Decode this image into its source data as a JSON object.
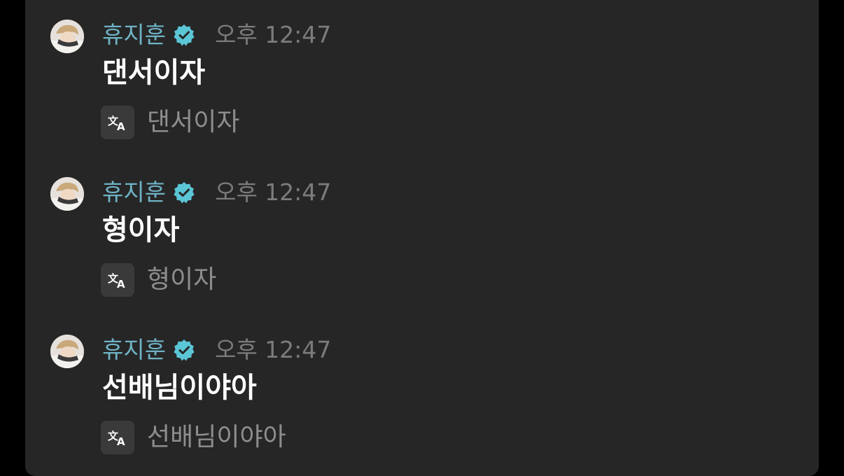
{
  "messages": [
    {
      "author": "휴지훈",
      "time": "오후 12:47",
      "text": "댄서이자",
      "translation": "댄서이자"
    },
    {
      "author": "휴지훈",
      "time": "오후 12:47",
      "text": "형이자",
      "translation": "형이자"
    },
    {
      "author": "휴지훈",
      "time": "오후 12:47",
      "text": "선배님이야아",
      "translation": "선배님이야아"
    }
  ],
  "colors": {
    "background": "#000000",
    "panel": "#262626",
    "author": "#6fb3c6",
    "verified": "#5bc6d6",
    "time": "#7c7c7c",
    "message_text": "#ffffff",
    "translation_text": "#8e8e8e"
  },
  "icons": {
    "avatar": "avatar-photo",
    "verified": "verified-badge-icon",
    "translate": "translate-icon"
  }
}
